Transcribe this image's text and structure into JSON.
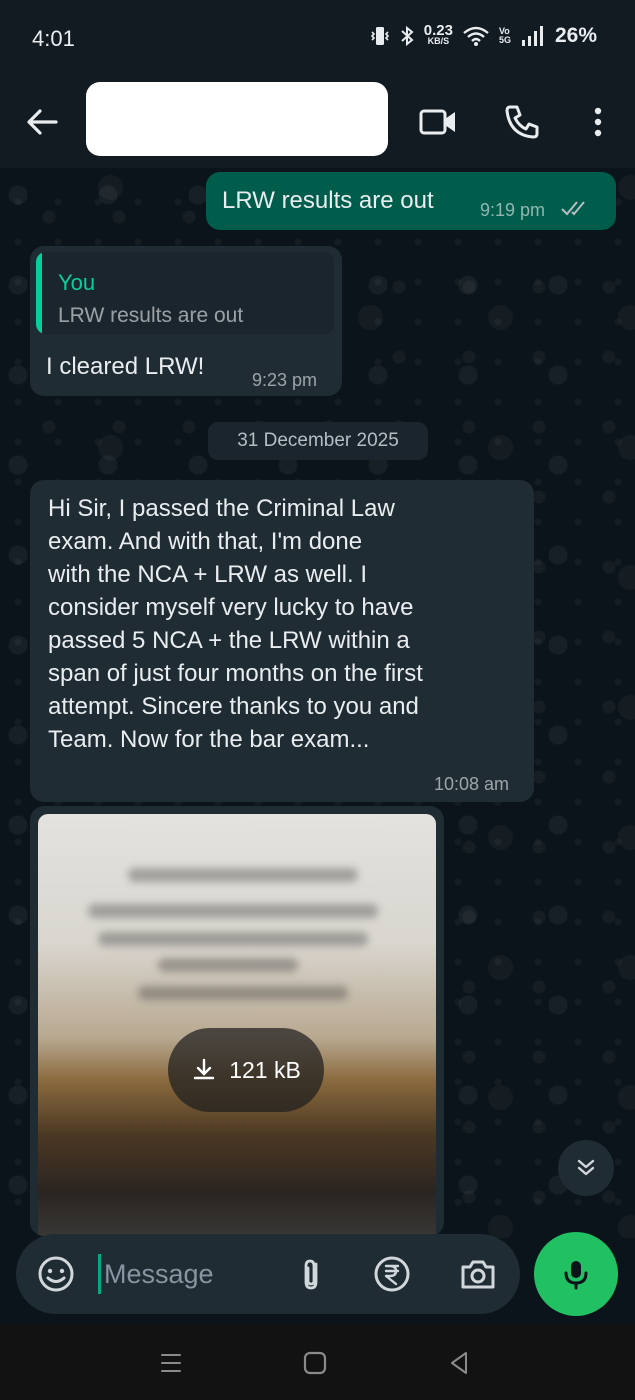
{
  "status_bar": {
    "time": "4:01",
    "net_speed_value": "0.23",
    "net_speed_unit": "KB/S",
    "volte_top": "Vo",
    "volte_bottom": "5G",
    "battery": "26%"
  },
  "header": {
    "contact_name": ""
  },
  "messages": {
    "m1": {
      "text": "LRW results are out",
      "time": "9:19 pm"
    },
    "m2": {
      "quote_author": "You",
      "quote_text": "LRW results are out",
      "text": "I cleared LRW!",
      "time": "9:23 pm"
    },
    "date_separator": "31 December 2025",
    "m3": {
      "lines": [
        "Hi Sir, I passed the Criminal Law",
        "exam.  And with that, I'm done",
        "with the NCA + LRW as well. I",
        "consider myself very lucky to have",
        "passed 5 NCA + the LRW within a",
        "span of just four months on the first",
        "attempt.  Sincere thanks to you and",
        "Team.  Now for the bar exam..."
      ],
      "time": "10:08 am"
    },
    "m4": {
      "download_size": "121 kB"
    }
  },
  "compose": {
    "placeholder": "Message"
  },
  "colors": {
    "background": "#0b141a",
    "outgoing_bubble": "#005c4b",
    "incoming_bubble": "#1f2c34",
    "accent_green": "#21c063",
    "quote_accent": "#06cf9c"
  },
  "icons": {
    "back": "arrow-left-icon",
    "video": "video-call-icon",
    "call": "phone-icon",
    "menu": "more-vert-icon",
    "ticks": "double-check-icon",
    "download": "download-icon",
    "scroll": "chevrons-down-icon",
    "emoji": "sticker-icon",
    "attach": "paperclip-icon",
    "payment": "rupee-icon",
    "camera": "camera-icon",
    "mic": "mic-icon"
  }
}
